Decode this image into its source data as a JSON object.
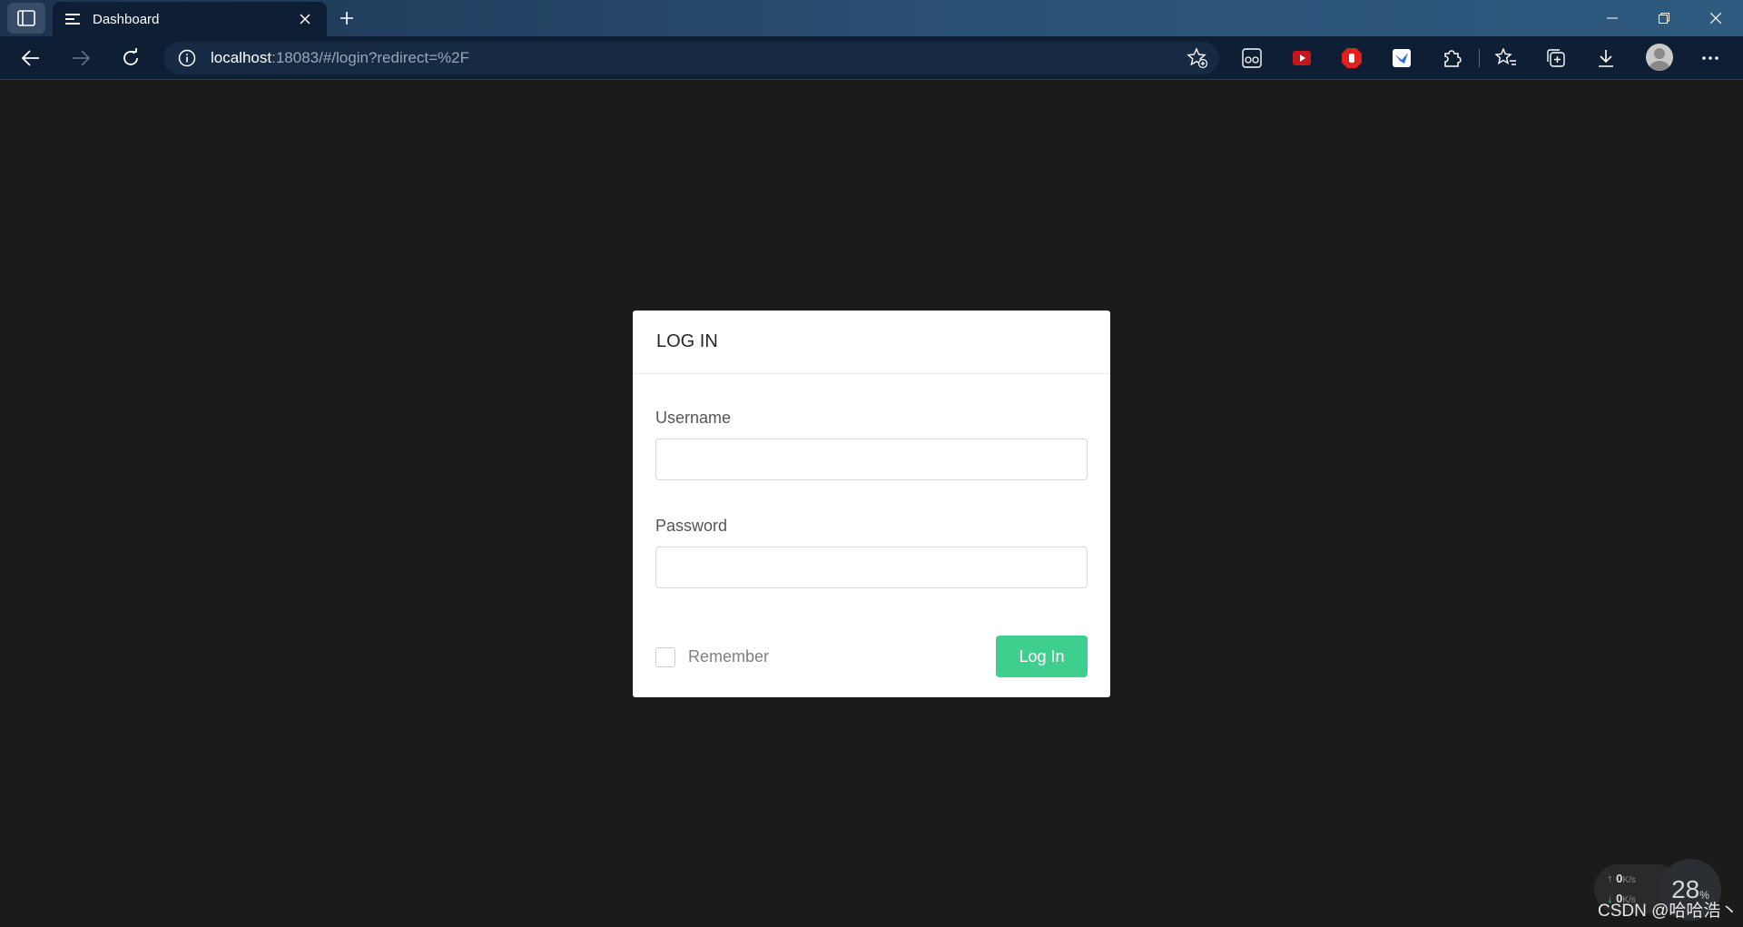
{
  "browser": {
    "tab": {
      "title": "Dashboard"
    },
    "address": {
      "host": "localhost",
      "rest": ":18083/#/login?redirect=%2F"
    }
  },
  "login": {
    "title": "LOG IN",
    "username_label": "Username",
    "username_value": "",
    "password_label": "Password",
    "password_value": "",
    "remember_label": "Remember",
    "submit_label": "Log In"
  },
  "colors": {
    "accent": "#3ecf8e",
    "page_bg": "#1b1b1b",
    "browser_bg": "#0e1e34"
  },
  "overlay": {
    "upload_speed": "0",
    "download_speed": "0",
    "speed_unit": "K/s",
    "gauge_value": "28",
    "gauge_unit": "%",
    "watermark": "CSDN @哈哈浩丶"
  }
}
